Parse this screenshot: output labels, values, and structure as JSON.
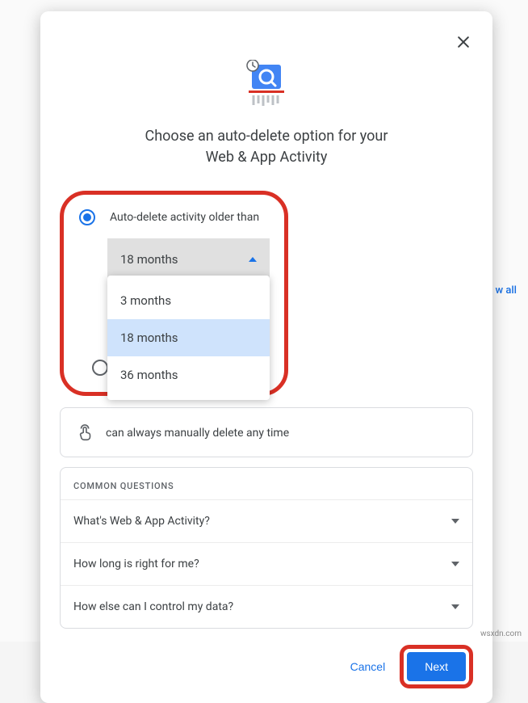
{
  "background": {
    "see_all": "w all"
  },
  "modal": {
    "title_line1": "Choose an auto-delete option for your",
    "title_line2": "Web & App Activity",
    "option1": {
      "label": "Auto-delete activity older than",
      "selected_value": "18 months",
      "options": [
        "3 months",
        "18 months",
        "36 months"
      ]
    },
    "option2": {
      "manual_text": "can always manually delete any time"
    },
    "faq": {
      "header": "COMMON QUESTIONS",
      "items": [
        "What's Web & App Activity?",
        "How long is right for me?",
        "How else can I control my data?"
      ]
    },
    "actions": {
      "cancel": "Cancel",
      "next": "Next"
    }
  },
  "watermark": "wsxdn.com"
}
